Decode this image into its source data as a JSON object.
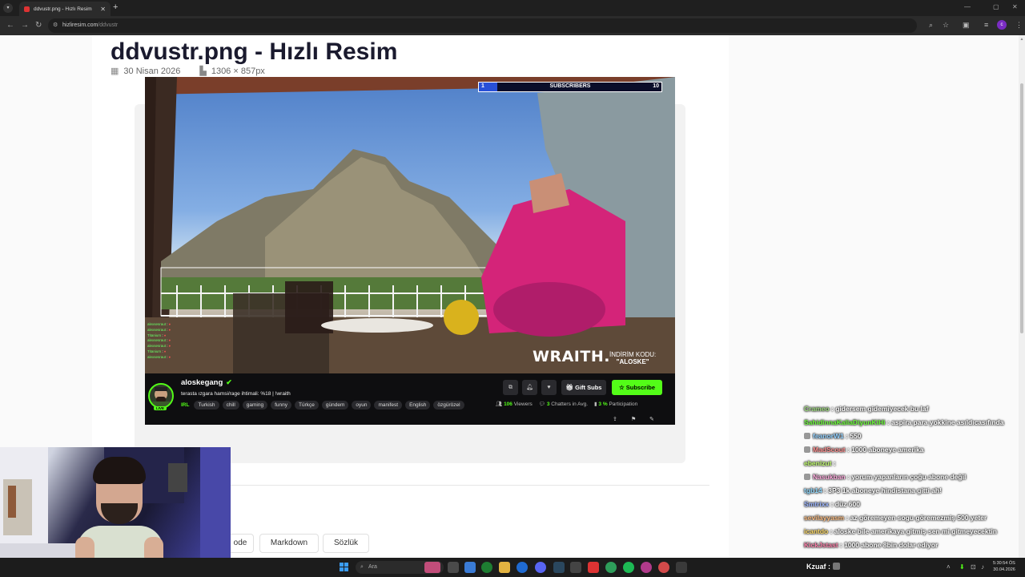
{
  "browser": {
    "tab_title": "ddvustr.png - Hızlı Resim",
    "url_host": "hizliresim.com",
    "url_path": "/ddvustr",
    "profile_initial": "c"
  },
  "page": {
    "title": "ddvustr.png - Hızlı Resim",
    "date": "30 Nisan 2026",
    "dimensions": "1306 × 857px",
    "format_buttons": [
      "ode",
      "Markdown",
      "Sözlük"
    ]
  },
  "stream": {
    "subs_goal": {
      "current": "1",
      "label": "SUBSCRIBERS",
      "target": "10",
      "progress": 0.1
    },
    "mini_chat": [
      {
        "name": "alexsesraut",
        "text": "♦"
      },
      {
        "name": "alexsesraut",
        "text": "♦"
      },
      {
        "name": "Titanium",
        "text": "♦"
      },
      {
        "name": "alexsesraut",
        "text": "♦"
      },
      {
        "name": "alexsesraut",
        "text": "♦"
      },
      {
        "name": "Titanium",
        "text": "♦"
      },
      {
        "name": "alexsesraut",
        "text": "♦"
      }
    ],
    "sponsor": "WRAITH.",
    "promo_line1": "İNDİRİM KODU:",
    "promo_code": "\"ALOSKE\"",
    "channel": "aloskegang",
    "live_label": "LIVE",
    "stream_title": "terasta ızgara hamsi/rage ihtimali: %18 | !wraith",
    "category": "IRL",
    "tags": [
      "Turkish",
      "chill",
      "gaming",
      "funny",
      "Türkçe",
      "gündem",
      "oyun",
      "manifest",
      "English",
      "özgürözel"
    ],
    "gift_label": "Gift Subs",
    "subscribe_label": "Subscribe",
    "viewers_count": "106",
    "viewers_label": "Viewers",
    "chatters_count": "3",
    "chatters_label": "Chatters in Avg.",
    "participation_count": "3 %",
    "participation_label": "Participation"
  },
  "overlay_chat": [
    {
      "user": "Crameo",
      "color": "#8fd46a",
      "text": ": gidersem gidemiyecek bu laf"
    },
    {
      "user": "SahidinnaKaliaDiyunKiHi",
      "color": "#53fc18",
      "text": ": aspira para yokkine asıldıcasıfında"
    },
    {
      "user": "feanorW1",
      "color": "#7fc9ff",
      "text": ": 550"
    },
    {
      "user": "MadScout",
      "color": "#ff7b7b",
      "text": ": 1000 aboneye amerika"
    },
    {
      "user": "ebenizut",
      "color": "#b8ff57",
      "text": ":"
    },
    {
      "user": "Nasukban",
      "color": "#ff9cd8",
      "text": ": yorum yapanların çoğu abone değil"
    },
    {
      "user": "tgb14",
      "color": "#7fd4ff",
      "text": ": 3P3 1k aboneye hindistana gitti ah!"
    },
    {
      "user": "Smtrixx",
      "color": "#8aa8ff",
      "text": ": düz 600"
    },
    {
      "user": "sevilayyasm",
      "color": "#ffb36b",
      "text": ": az göremeyen sogu göremezmiş 500 yeter"
    },
    {
      "user": "icantdo",
      "color": "#ffd54a",
      "text": ": aloske bile amerikaya gitmiş sen mi gitmeyecektin"
    },
    {
      "user": "KickJstast",
      "color": "#ff6b9c",
      "text": ": 1000 abone 8bin dolar ediyor"
    }
  ],
  "overlay_last": {
    "user": "Kzuaf",
    "text": ":"
  },
  "taskbar": {
    "search_placeholder": "Ara",
    "time": "5:30:54 ÖS",
    "date": "30.04.2026"
  }
}
